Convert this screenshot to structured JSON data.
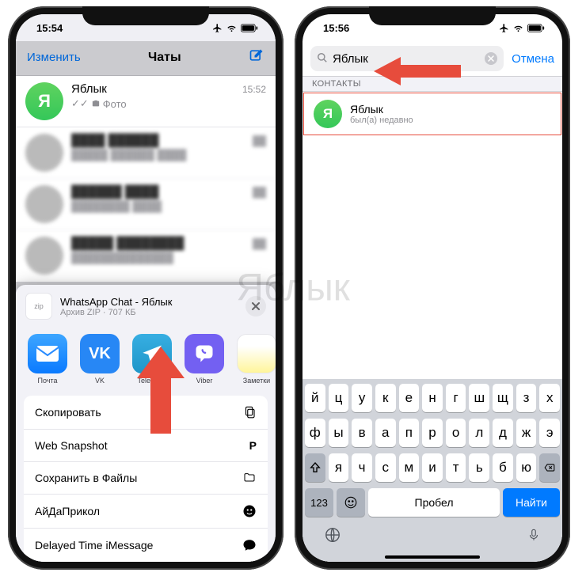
{
  "watermark": "Яблык",
  "left": {
    "status_time": "15:54",
    "nav": {
      "edit": "Изменить",
      "title": "Чаты"
    },
    "chat0": {
      "avatar": "Я",
      "name": "Яблык",
      "time": "15:52",
      "sub": "Фото"
    },
    "share": {
      "file_title": "WhatsApp Chat - Яблык",
      "file_sub": "Архив ZIP · 707 КБ",
      "zip_label": "zip",
      "apps": {
        "mail": "Почта",
        "vk": "VK",
        "telegram": "Telegram",
        "viber": "Viber",
        "notes": "Заметки"
      },
      "actions": {
        "copy": "Скопировать",
        "web_snapshot": "Web Snapshot",
        "save_files": "Сохранить в Файлы",
        "aidaprikol": "АйДаПрикол",
        "delayed_imsg": "Delayed Time iMessage"
      }
    }
  },
  "right": {
    "status_time": "15:56",
    "search": {
      "query": "Яблык",
      "cancel": "Отмена"
    },
    "section_header": "КОНТАКТЫ",
    "result": {
      "avatar": "Я",
      "name": "Яблык",
      "status": "был(а) недавно"
    },
    "keyboard": {
      "row1": [
        "й",
        "ц",
        "у",
        "к",
        "е",
        "н",
        "г",
        "ш",
        "щ",
        "з",
        "х"
      ],
      "row2": [
        "ф",
        "ы",
        "в",
        "а",
        "п",
        "р",
        "о",
        "л",
        "д",
        "ж",
        "э"
      ],
      "row3": [
        "я",
        "ч",
        "с",
        "м",
        "и",
        "т",
        "ь",
        "б",
        "ю"
      ],
      "k123": "123",
      "space": "Пробел",
      "find": "Найти"
    }
  }
}
